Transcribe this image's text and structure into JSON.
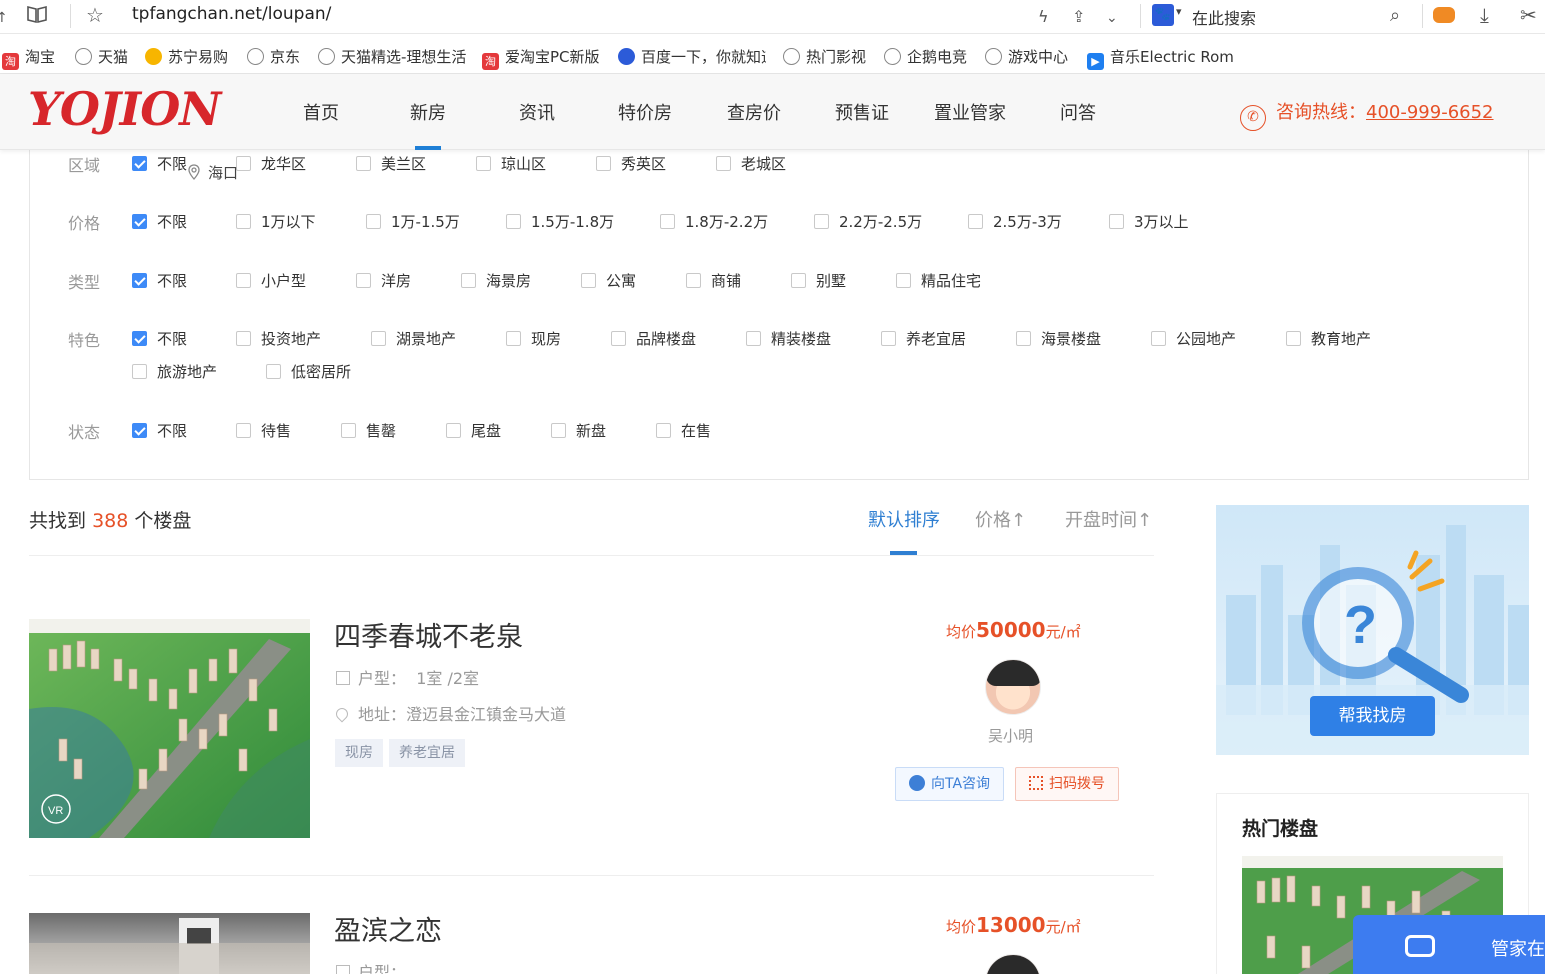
{
  "browser": {
    "url": "tpfangchan.net/loupan/",
    "search_placeholder": "在此搜索",
    "bookmarks": [
      {
        "label": "淘宝",
        "icon": "taobao-icon"
      },
      {
        "label": "天猫",
        "icon": "globe-icon"
      },
      {
        "label": "苏宁易购",
        "icon": "suning-icon"
      },
      {
        "label": "京东",
        "icon": "globe-icon"
      },
      {
        "label": "天猫精选-理想生活",
        "icon": "globe-icon"
      },
      {
        "label": "爱淘宝PC新版",
        "icon": "taobao-icon"
      },
      {
        "label": "百度一下，你就知道",
        "icon": "baidu-icon"
      },
      {
        "label": "热门影视",
        "icon": "globe-icon"
      },
      {
        "label": "企鹅电竞",
        "icon": "globe-icon"
      },
      {
        "label": "游戏中心",
        "icon": "globe-icon"
      },
      {
        "label": "音乐Electric Rom",
        "icon": "music-icon"
      }
    ]
  },
  "header": {
    "logo": "YOJION",
    "nav": [
      "首页",
      "新房",
      "资讯",
      "特价房",
      "查房价",
      "预售证",
      "置业管家",
      "问答"
    ],
    "active_nav": "新房",
    "hotline_label": "咨询热线：",
    "hotline_number": "400-999-6652"
  },
  "filters": {
    "location_tip": "海口",
    "rows": [
      {
        "label": "区域",
        "options": [
          "不限",
          "龙华区",
          "美兰区",
          "琼山区",
          "秀英区",
          "老城区"
        ]
      },
      {
        "label": "价格",
        "options": [
          "不限",
          "1万以下",
          "1万-1.5万",
          "1.5万-1.8万",
          "1.8万-2.2万",
          "2.2万-2.5万",
          "2.5万-3万",
          "3万以上"
        ]
      },
      {
        "label": "类型",
        "options": [
          "不限",
          "小户型",
          "洋房",
          "海景房",
          "公寓",
          "商铺",
          "别墅",
          "精品住宅"
        ]
      },
      {
        "label": "特色",
        "options": [
          "不限",
          "投资地产",
          "湖景地产",
          "现房",
          "品牌楼盘",
          "精装楼盘",
          "养老宜居",
          "海景楼盘",
          "公园地产",
          "教育地产",
          "旅游地产",
          "低密居所"
        ]
      },
      {
        "label": "状态",
        "options": [
          "不限",
          "待售",
          "售罄",
          "尾盘",
          "新盘",
          "在售"
        ]
      }
    ]
  },
  "results": {
    "prefix": "共找到",
    "count": "388",
    "suffix": "个楼盘",
    "sorts": [
      "默认排序",
      "价格↑",
      "开盘时间↑"
    ],
    "active_sort": "默认排序"
  },
  "listings": [
    {
      "title": "四季春城不老泉",
      "layout_label": "户型：",
      "layout": "1室 /2室",
      "address_label": "地址：",
      "address": "澄迈县金江镇金马大道",
      "tags": [
        "现房",
        "养老宜居"
      ],
      "price_prefix": "均价",
      "price": "50000",
      "price_unit": "元/㎡",
      "agent": "吴小明",
      "ask_label": "向TA咨询",
      "scan_label": "扫码拨号",
      "vr_badge": "VR"
    },
    {
      "title": "盈滨之恋",
      "layout_label": "户型：",
      "price_prefix": "均价",
      "price": "13000",
      "price_unit": "元/㎡"
    }
  ],
  "sidebar": {
    "help_button": "帮我找房",
    "hot_title": "热门楼盘",
    "float_label": "管家在"
  },
  "colors": {
    "accent_blue": "#2f7fd2",
    "accent_orange": "#e65128",
    "logo_red": "#d7262b"
  }
}
